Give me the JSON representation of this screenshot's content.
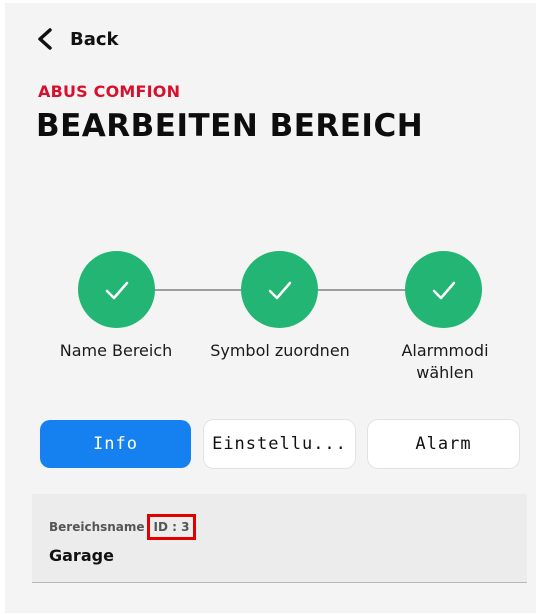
{
  "header": {
    "back_label": "Back",
    "brand": "ABUS COMFION",
    "title": "BEARBEITEN BEREICH"
  },
  "stepper": {
    "steps": [
      {
        "label_line1": "Name Bereich",
        "label_line2": "",
        "status": "done",
        "icon": "check-icon"
      },
      {
        "label_line1": "Symbol zuordnen",
        "label_line2": "",
        "status": "done",
        "icon": "check-icon"
      },
      {
        "label_line1": "Alarmmodi",
        "label_line2": "wählen",
        "status": "done",
        "icon": "check-icon"
      }
    ]
  },
  "tabs": [
    {
      "label": "Info",
      "active": true
    },
    {
      "label": "Einstellu...",
      "active": false
    },
    {
      "label": "Alarm",
      "active": false
    }
  ],
  "field": {
    "label": "Bereichsname",
    "id_text": "ID : 3",
    "value": "Garage"
  },
  "colors": {
    "brand": "#d8102d",
    "step_done": "#22b573",
    "tab_active": "#1580f0",
    "highlight_box": "#e00000"
  }
}
